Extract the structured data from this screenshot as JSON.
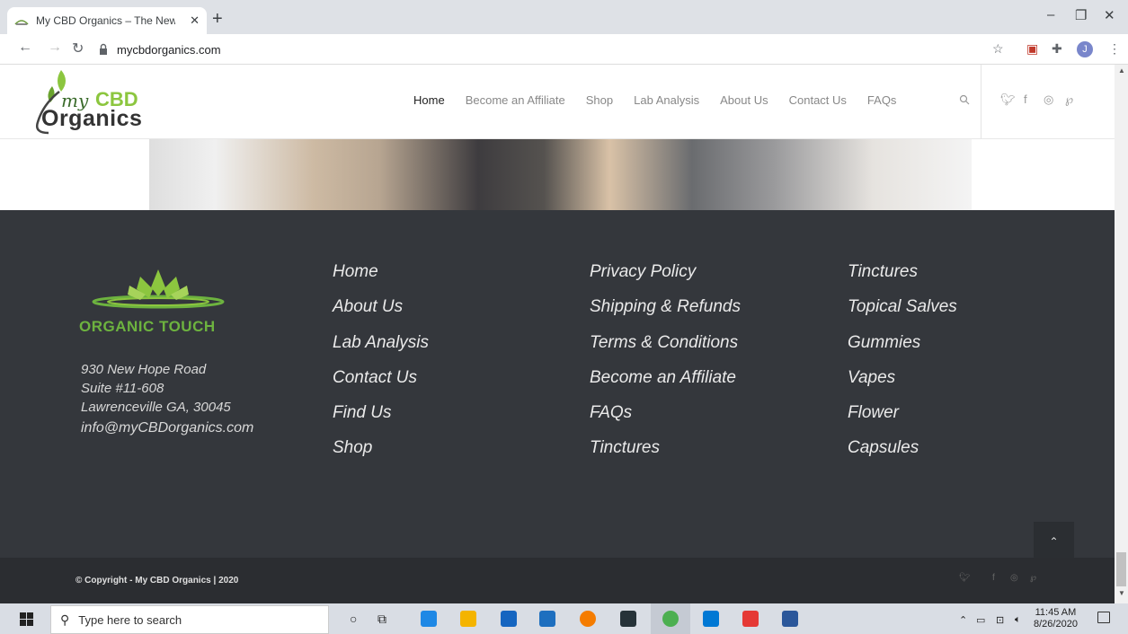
{
  "browser": {
    "tab_title": "My CBD Organics – The New Star",
    "tab_close": "✕",
    "new_tab": "+",
    "url": "mycbdorganics.com",
    "avatar_letter": "J",
    "minimize": "–",
    "restore": "❐",
    "close": "✕"
  },
  "site": {
    "logo": {
      "my": "my",
      "cbd": "CBD",
      "organics": "Organics"
    },
    "nav": [
      "Home",
      "Become an Affiliate",
      "Shop",
      "Lab Analysis",
      "About Us",
      "Contact Us",
      "FAQs"
    ],
    "active_nav": "Home",
    "social": [
      "twitter-icon",
      "facebook-icon",
      "instagram-icon",
      "pinterest-icon"
    ]
  },
  "footer": {
    "brand": "ORGANIC TOUCH",
    "address": [
      "930 New Hope Road",
      "Suite #11-608",
      "Lawrenceville GA, 30045",
      "info@myCBDorganics.com"
    ],
    "col1": [
      "Home",
      "About Us",
      "Lab Analysis",
      "Contact Us",
      "Find Us",
      "Shop"
    ],
    "col2": [
      "Privacy Policy",
      "Shipping & Refunds",
      "Terms & Conditions",
      "Become an Affiliate",
      "FAQs",
      "Tinctures"
    ],
    "col3": [
      "Tinctures",
      "Topical Salves",
      "Gummies",
      "Vapes",
      "Flower",
      "Capsules"
    ],
    "copyright": "© Copyright - My CBD Organics | 2020",
    "back_to_top": "⌃"
  },
  "taskbar": {
    "search_placeholder": "Type here to search",
    "time": "11:45 AM",
    "date": "8/26/2020"
  },
  "colors": {
    "brand_green": "#8cc63f",
    "footer_bg": "#34373c",
    "copyright_bg": "#2b2d31"
  }
}
